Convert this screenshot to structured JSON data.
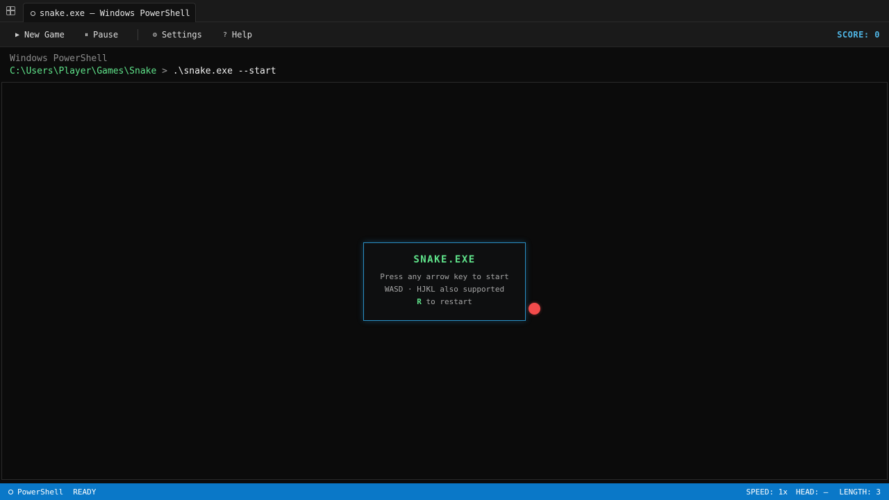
{
  "window": {
    "tab_title": "snake.exe — Windows PowerShell"
  },
  "toolbar": {
    "new_game": {
      "glyph": "▶",
      "label": "New Game"
    },
    "pause": {
      "glyph": "⏸",
      "label": "Pause"
    },
    "settings": {
      "glyph": "⚙",
      "label": "Settings"
    },
    "help": {
      "glyph": "?",
      "label": "Help"
    },
    "score": "SCORE: 0"
  },
  "terminal": {
    "title": "Windows PowerShell",
    "prompt_path": "C:\\Users\\Player\\Games\\Snake",
    "prompt_separator": " > ",
    "command": ".\\snake.exe --start"
  },
  "dialog": {
    "title": "SNAKE.EXE",
    "line1": "Press any arrow key to start",
    "line2": "WASD · HJKL also supported",
    "restart_key": "R",
    "restart_text": " to restart"
  },
  "statusbar": {
    "shell": "PowerShell",
    "state": "READY",
    "speed": "SPEED: 1x",
    "head": "HEAD: —",
    "length": "LENGTH: 3"
  },
  "colors": {
    "accent": "#4fb6e6",
    "snake_green": "#5fe38a",
    "food": "#f24b4b",
    "statusbar": "#0a78c8"
  },
  "icons": {
    "tabs": "tabs-grid-icon",
    "tab": "terminal-tab-icon",
    "food": "food-apple-icon"
  }
}
